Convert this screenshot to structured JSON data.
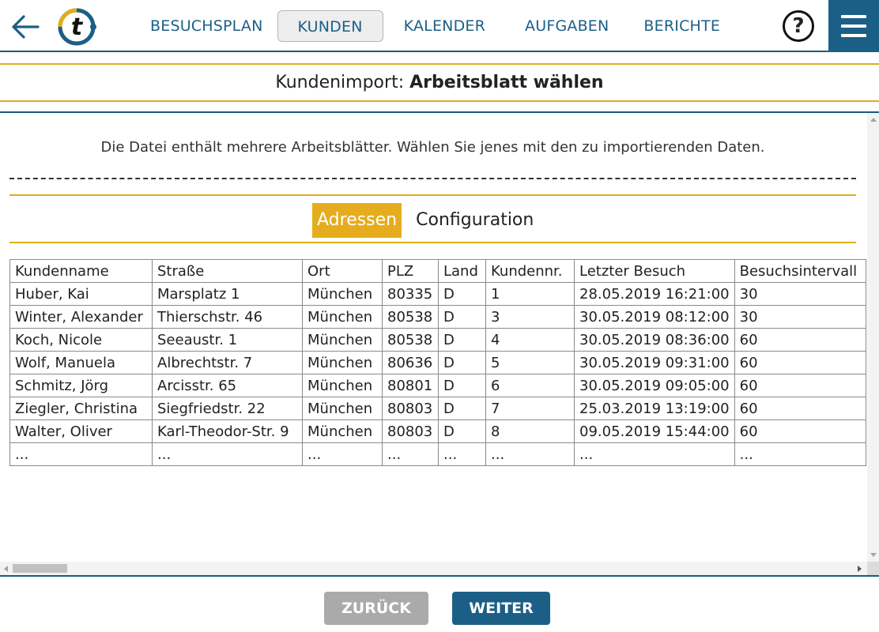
{
  "header": {
    "nav": [
      {
        "label": "BESUCHSPLAN",
        "active": false
      },
      {
        "label": "KUNDEN",
        "active": true
      },
      {
        "label": "KALENDER",
        "active": false
      },
      {
        "label": "AUFGABEN",
        "active": false
      },
      {
        "label": "BERICHTE",
        "active": false
      }
    ],
    "help_label": "?",
    "logo_letter": "t",
    "icons": {
      "back": "arrow-left-icon",
      "logo": "logo-icon",
      "help": "help-icon",
      "menu": "hamburger-menu-icon"
    },
    "colors": {
      "primary": "#1c5f86",
      "accent": "#e2ac1c"
    }
  },
  "title": {
    "prefix": "Kundenimport: ",
    "strong": "Arbeitsblatt wählen"
  },
  "description": "Die Datei enthält mehrere Arbeitsblätter. Wählen Sie jenes mit den zu importierenden Daten.",
  "sheets": [
    {
      "label": "Adressen",
      "active": true
    },
    {
      "label": "Configuration",
      "active": false
    }
  ],
  "table": {
    "columns": [
      "Kundenname",
      "Straße",
      "Ort",
      "PLZ",
      "Land",
      "Kundennr.",
      "Letzter Besuch",
      "Besuchsintervall"
    ],
    "rows": [
      [
        "Huber, Kai",
        "Marsplatz 1",
        "München",
        "80335",
        "D",
        "1",
        "28.05.2019 16:21:00",
        "30"
      ],
      [
        "Winter, Alexander",
        "Thierschstr. 46",
        "München",
        "80538",
        "D",
        "3",
        "30.05.2019 08:12:00",
        "30"
      ],
      [
        "Koch, Nicole",
        "Seeaustr. 1",
        "München",
        "80538",
        "D",
        "4",
        "30.05.2019 08:36:00",
        "60"
      ],
      [
        "Wolf, Manuela",
        "Albrechtstr. 7",
        "München",
        "80636",
        "D",
        "5",
        "30.05.2019 09:31:00",
        "60"
      ],
      [
        "Schmitz, Jörg",
        "Arcisstr. 65",
        "München",
        "80801",
        "D",
        "6",
        "30.05.2019 09:05:00",
        "60"
      ],
      [
        "Ziegler, Christina",
        "Siegfriedstr. 22",
        "München",
        "80803",
        "D",
        "7",
        "25.03.2019 13:19:00",
        "60"
      ],
      [
        "Walter, Oliver",
        "Karl-Theodor-Str. 9",
        "München",
        "80803",
        "D",
        "8",
        "09.05.2019 15:44:00",
        "60"
      ],
      [
        "...",
        "...",
        "...",
        "...",
        "...",
        "...",
        "...",
        "..."
      ]
    ]
  },
  "footer": {
    "back_label": "ZURÜCK",
    "next_label": "WEITER"
  }
}
